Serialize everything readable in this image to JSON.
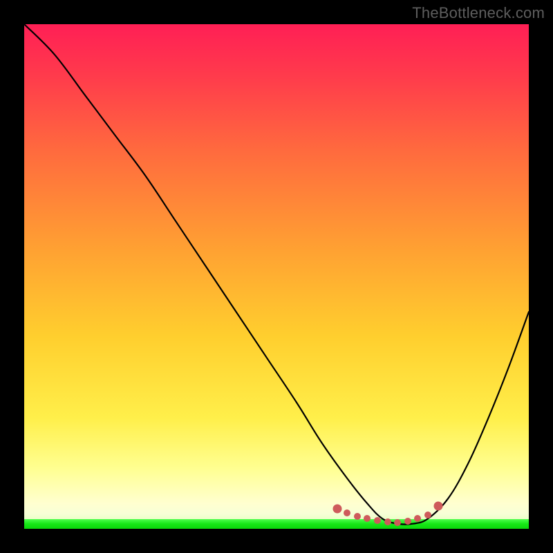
{
  "watermark": "TheBottleneck.com",
  "colors": {
    "gradient_top": "#ff1f55",
    "gradient_mid": "#ffd930",
    "gradient_low": "#ffffbd",
    "green": "#16e816",
    "curve": "#000000",
    "dot": "#ce5b5b",
    "background": "#000000",
    "watermark_text": "#5e5e5e"
  },
  "chart_data": {
    "type": "line",
    "title": "",
    "xlabel": "",
    "ylabel": "",
    "xlim": [
      0,
      100
    ],
    "ylim": [
      0,
      100
    ],
    "grid": false,
    "series": [
      {
        "name": "bottleneck-curve",
        "x": [
          0,
          6,
          12,
          18,
          24,
          30,
          36,
          42,
          48,
          54,
          59,
          64,
          68,
          71,
          74,
          77,
          80,
          84,
          88,
          92,
          96,
          100
        ],
        "values": [
          100,
          94,
          86,
          78,
          70,
          61,
          52,
          43,
          34,
          25,
          17,
          10,
          5,
          2,
          1,
          1,
          2,
          6,
          13,
          22,
          32,
          43
        ]
      }
    ],
    "highlight_points": {
      "name": "valley-dots",
      "x": [
        62,
        64,
        66,
        68,
        70,
        72,
        74,
        76,
        78,
        80,
        82
      ],
      "values": [
        4,
        3.2,
        2.5,
        2.0,
        1.6,
        1.4,
        1.3,
        1.5,
        2.0,
        2.8,
        4.5
      ]
    },
    "annotations": []
  }
}
